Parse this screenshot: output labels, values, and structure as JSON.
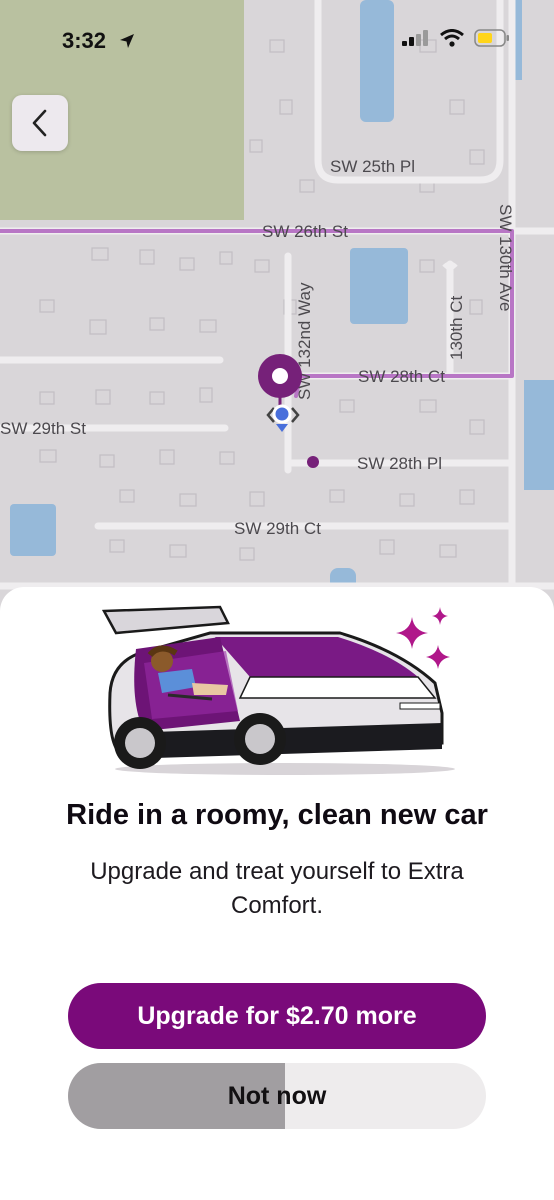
{
  "status_bar": {
    "time": "3:32",
    "icons": [
      "location-arrow-icon",
      "cellular-signal-icon",
      "wifi-icon",
      "battery-icon"
    ],
    "battery_color": "#ffd51a"
  },
  "map": {
    "streets": [
      "SW 25th Pl",
      "SW 26th St",
      "SW 132nd Way",
      "130th Ct",
      "SW 130th Ave",
      "SW 28th Ct",
      "SW 29th St",
      "SW 28th Pl",
      "SW 29th Ct"
    ],
    "route_color": "#b26bc0",
    "pin_color": "#6b0f6e"
  },
  "sheet": {
    "headline": "Ride in a roomy, clean new car",
    "subtext": "Upgrade and treat yourself to Extra Comfort.",
    "upgrade_label": "Upgrade for $2.70 more",
    "dismiss_label": "Not now",
    "dismiss_progress_fraction": 0.52,
    "brand_color": "#7a0a7a"
  }
}
